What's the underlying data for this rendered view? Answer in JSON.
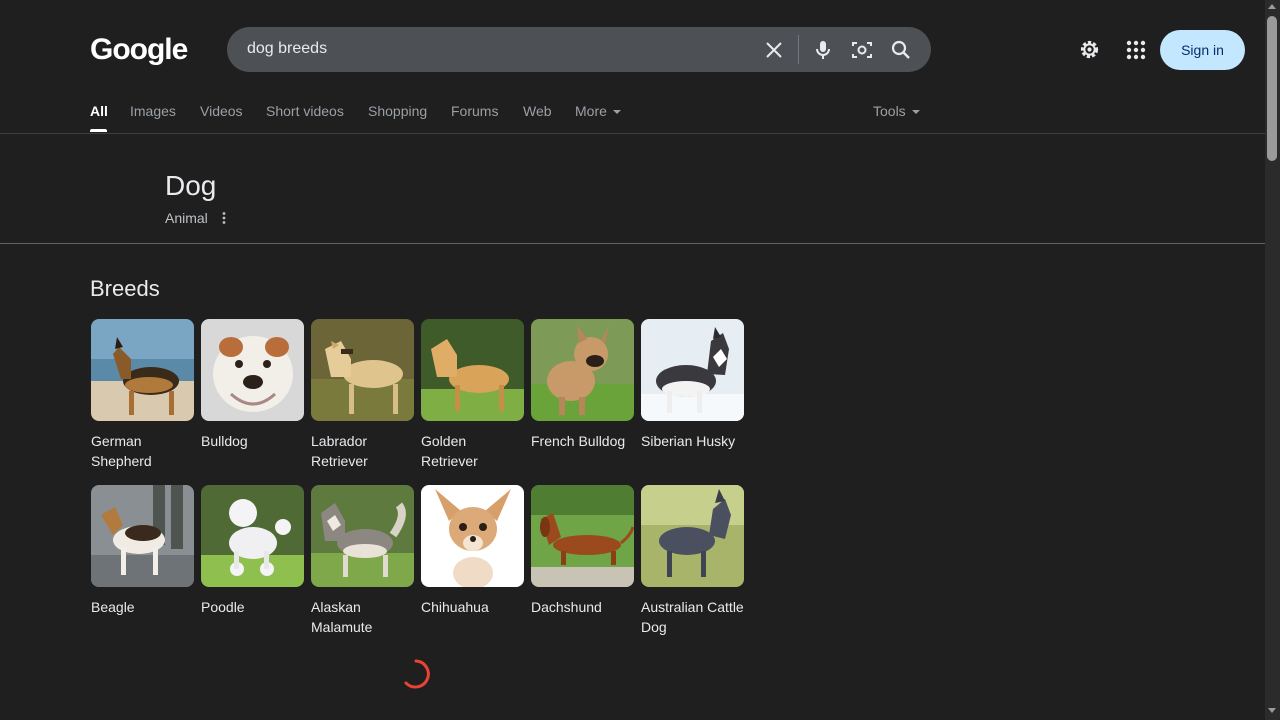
{
  "logo": "Google",
  "search": {
    "query": "dog breeds"
  },
  "header": {
    "signin_label": "Sign in"
  },
  "tabs": [
    {
      "label": "All"
    },
    {
      "label": "Images"
    },
    {
      "label": "Videos"
    },
    {
      "label": "Short videos"
    },
    {
      "label": "Shopping"
    },
    {
      "label": "Forums"
    },
    {
      "label": "Web"
    },
    {
      "label": "More"
    }
  ],
  "tools_label": "Tools",
  "entity": {
    "title": "Dog",
    "subtitle": "Animal"
  },
  "breeds_section": {
    "title": "Breeds",
    "items": [
      {
        "name": "German Shepherd"
      },
      {
        "name": "Bulldog"
      },
      {
        "name": "Labrador Retriever"
      },
      {
        "name": "Golden Retriever"
      },
      {
        "name": "French Bulldog"
      },
      {
        "name": "Siberian Husky"
      },
      {
        "name": "Beagle"
      },
      {
        "name": "Poodle"
      },
      {
        "name": "Alaskan Malamute"
      },
      {
        "name": "Chihuahua"
      },
      {
        "name": "Dachshund"
      },
      {
        "name": "Australian Cattle Dog"
      }
    ]
  },
  "colors": {
    "background": "#1f1f1f",
    "search_bg": "#4d5156",
    "signin_bg": "#c2e7ff",
    "spinner": "#ea4335"
  }
}
